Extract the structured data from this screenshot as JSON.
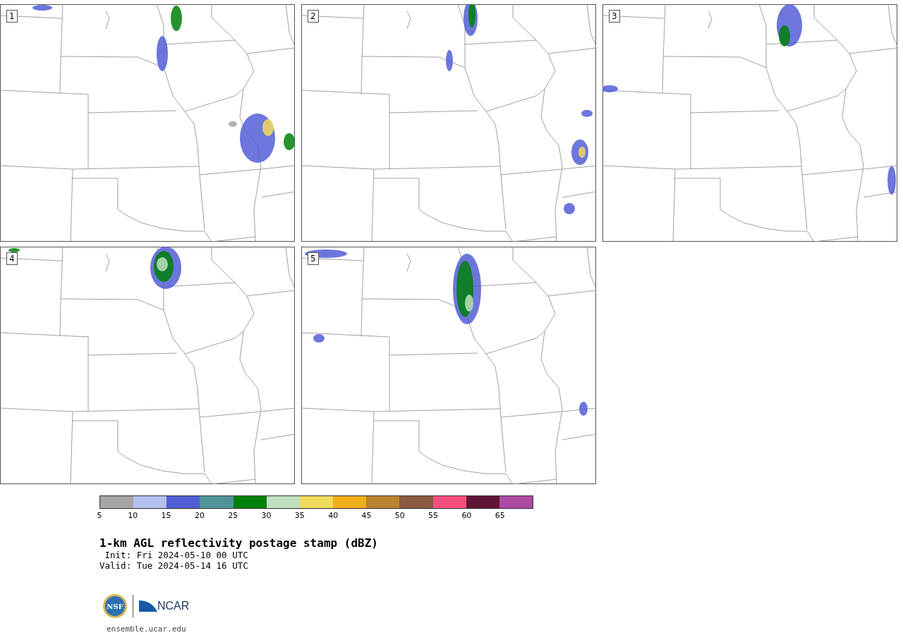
{
  "panels": [
    {
      "number": "1"
    },
    {
      "number": "2"
    },
    {
      "number": "3"
    },
    {
      "number": "4"
    },
    {
      "number": "5"
    }
  ],
  "colorbar": {
    "segments": [
      {
        "color": "#a5a5a5"
      },
      {
        "color": "#b5c0ee"
      },
      {
        "color": "#525ed6"
      },
      {
        "color": "#4f9499"
      },
      {
        "color": "#00800a"
      },
      {
        "color": "#bfdfbf"
      },
      {
        "color": "#f0da5c"
      },
      {
        "color": "#f0ae1a"
      },
      {
        "color": "#b9832f"
      },
      {
        "color": "#8b5a3f"
      },
      {
        "color": "#f54f7e"
      },
      {
        "color": "#611536"
      },
      {
        "color": "#ad4aa3"
      }
    ],
    "ticks": [
      "5",
      "10",
      "15",
      "20",
      "25",
      "30",
      "35",
      "40",
      "45",
      "50",
      "55",
      "60",
      "65"
    ]
  },
  "title": "1-km AGL reflectivity postage stamp (dBZ)",
  "init": " Init: Fri 2024-05-10 00 UTC",
  "valid": "Valid: Tue 2024-05-14 16 UTC",
  "logo": {
    "left": "NSF",
    "right": "NCAR"
  },
  "site": "ensemble.ucar.edu"
}
